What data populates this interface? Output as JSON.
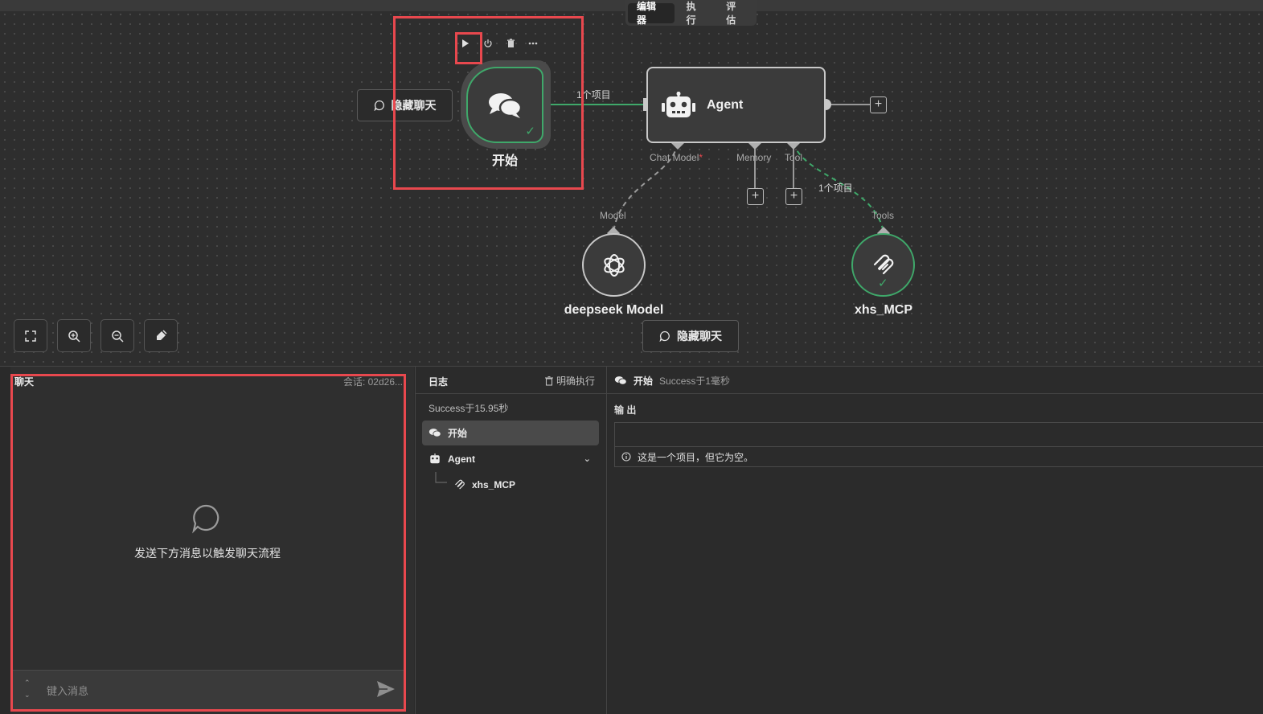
{
  "editor": {
    "tabs": [
      {
        "label": "编辑器",
        "active": true
      },
      {
        "label": "执行",
        "active": false
      },
      {
        "label": "评估",
        "active": false
      }
    ]
  },
  "nodes": {
    "start": {
      "title": "开始",
      "status": "success"
    },
    "agent": {
      "title": "Agent"
    },
    "model": {
      "title": "deepseek Model"
    },
    "tool": {
      "title": "xhs_MCP",
      "status": "success"
    }
  },
  "edges": {
    "start_to_agent_label": "1个项目",
    "tool_to_agent_label": "1个项目"
  },
  "ports": {
    "chat_model": "Chat Model",
    "chat_model_required_mark": "*",
    "memory": "Memory",
    "tool": "Tool",
    "model": "Model",
    "tools": "Tools"
  },
  "buttons": {
    "hide_chat": "隐藏聊天",
    "hide_chat_bottom": "隐藏聊天"
  },
  "chat": {
    "title": "聊天",
    "session": "会话: 02d26...",
    "empty_text": "发送下方消息以触发聊天流程",
    "input_placeholder": "键入消息"
  },
  "logs": {
    "title": "日志",
    "clear_label": "明确执行",
    "status": "Success于15.95秒",
    "items": [
      {
        "label": "开始"
      },
      {
        "label": "Agent"
      },
      {
        "label": "xhs_MCP"
      }
    ]
  },
  "output": {
    "node_name": "开始",
    "status": "Success于1毫秒",
    "section_label": "输 出",
    "empty_message": "这是一个项目，但它为空。"
  },
  "colors": {
    "success": "#3fa86a",
    "highlight": "#e8484e"
  }
}
